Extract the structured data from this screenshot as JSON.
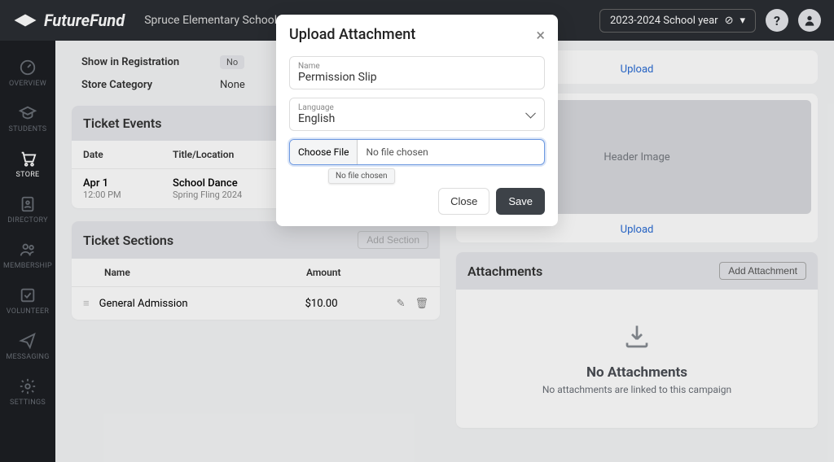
{
  "brand": "FutureFund",
  "school": "Spruce Elementary School",
  "year": "2023-2024 School year",
  "nav": {
    "overview": "OVERVIEW",
    "students": "STUDENTS",
    "store": "STORE",
    "directory": "DIRECTORY",
    "membership": "MEMBERSHIP",
    "volunteer": "VOLUNTEER",
    "messaging": "MESSAGING",
    "settings": "SETTINGS"
  },
  "fields": {
    "show_in_reg_label": "Show in Registration",
    "show_in_reg_value": "No",
    "store_cat_label": "Store Category",
    "store_cat_value": "None"
  },
  "ticket_events": {
    "title": "Ticket Events",
    "col_date": "Date",
    "col_title": "Title/Location",
    "row": {
      "date": "Apr 1",
      "time": "12:00 PM",
      "title": "School Dance",
      "sub": "Spring Fling 2024"
    }
  },
  "ticket_sections": {
    "title": "Ticket Sections",
    "add_btn": "Add Section",
    "col_name": "Name",
    "col_amount": "Amount",
    "row": {
      "name": "General Admission",
      "amount": "$10.00"
    }
  },
  "right": {
    "upload": "Upload",
    "header_image": "Header Image"
  },
  "attachments": {
    "title": "Attachments",
    "add_btn": "Add Attachment",
    "empty_title": "No Attachments",
    "empty_sub": "No attachments are linked to this campaign"
  },
  "modal": {
    "title": "Upload Attachment",
    "name_label": "Name",
    "name_value": "Permission Slip",
    "lang_label": "Language",
    "lang_value": "English",
    "choose_file": "Choose File",
    "no_file": "No file chosen",
    "tooltip": "No file chosen",
    "close": "Close",
    "save": "Save"
  }
}
